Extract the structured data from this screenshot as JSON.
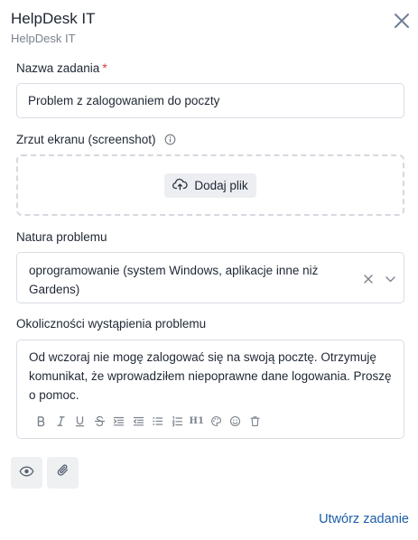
{
  "header": {
    "title": "HelpDesk IT",
    "subtitle": "HelpDesk IT"
  },
  "form": {
    "task_name": {
      "label": "Nazwa zadania",
      "required_mark": "*",
      "value": "Problem z zalogowaniem do poczty"
    },
    "screenshot": {
      "label": "Zrzut ekranu (screenshot)",
      "upload_label": "Dodaj plik"
    },
    "problem_nature": {
      "label": "Natura problemu",
      "selected": "oprogramowanie (system Windows, aplikacje inne niż Gardens)"
    },
    "circumstances": {
      "label": "Okoliczności wystąpienia problemu",
      "value": "Od wczoraj nie mogę zalogować się na swoją pocztę. Otrzymuję komunikat, że wprowadziłem niepoprawne dane logowania. Proszę o pomoc.",
      "toolbar": [
        "bold-icon",
        "italic-icon",
        "underline-icon",
        "strikethrough-icon",
        "indent-icon",
        "outdent-icon",
        "bullet-list-icon",
        "numbered-list-icon",
        "heading-icon",
        "palette-icon",
        "emoji-icon",
        "trash-icon"
      ],
      "heading_label": "H1"
    }
  },
  "footer": {
    "create_label": "Utwórz zadanie"
  },
  "colors": {
    "accent": "#1c5ea8",
    "required": "#d9393e",
    "border": "#d8dde3",
    "icon": "#7a828c"
  }
}
